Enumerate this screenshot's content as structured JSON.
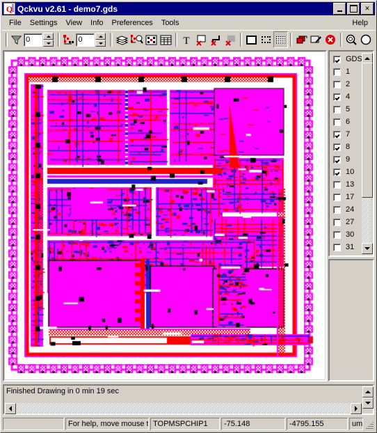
{
  "window": {
    "title": "Qckvu v2.61 - demo7.gds",
    "icon": "app-q-icon",
    "buttons": [
      {
        "name": "minimize-button",
        "label": "_"
      },
      {
        "name": "maximize-button",
        "label": "□"
      },
      {
        "name": "close-button",
        "label": "✕"
      }
    ]
  },
  "menu": {
    "items": [
      "File",
      "Settings",
      "View",
      "Info",
      "Preferences",
      "Tools"
    ],
    "help": "Help"
  },
  "toolbar": {
    "filter_value": "0",
    "filter_icon": "funnel-filter-icon",
    "depth_value": "0",
    "depth_icon": "hierarchy-depth-icon",
    "tools": [
      {
        "name": "layers-icon",
        "title": "Layers"
      },
      {
        "name": "inspect-hierarchy-icon",
        "title": "Inspect"
      },
      {
        "name": "cell-array-icon",
        "title": "Cell Array"
      },
      {
        "name": "table-grid-icon",
        "title": "Table"
      },
      {
        "name": "text-tool-icon",
        "title": "Text"
      },
      {
        "name": "hide-box-icon",
        "title": "Hide Box"
      },
      {
        "name": "hide-path-icon",
        "title": "Hide Path"
      },
      {
        "name": "hide-fill-icon",
        "title": "Hide Fill"
      },
      {
        "name": "outline-fill-icon",
        "title": "Outline"
      },
      {
        "name": "dotted-fill-icon",
        "title": "Dot Fill"
      },
      {
        "name": "solid-fill-icon",
        "title": "Solid Fill"
      },
      {
        "name": "color-swap-icon",
        "title": "Colors"
      },
      {
        "name": "edit-layer-icon",
        "title": "Edit Layer"
      },
      {
        "name": "cancel-icon",
        "title": "Cancel"
      },
      {
        "name": "zoom-in-icon",
        "title": "Zoom In"
      },
      {
        "name": "zoom-fit-icon",
        "title": "Zoom Fit"
      }
    ]
  },
  "layers": {
    "items": [
      {
        "label": "GDS",
        "checked": true
      },
      {
        "label": "1",
        "checked": false
      },
      {
        "label": "2",
        "checked": false
      },
      {
        "label": "4",
        "checked": true
      },
      {
        "label": "5",
        "checked": false
      },
      {
        "label": "6",
        "checked": false
      },
      {
        "label": "7",
        "checked": true
      },
      {
        "label": "8",
        "checked": true
      },
      {
        "label": "9",
        "checked": true
      },
      {
        "label": "10",
        "checked": true
      },
      {
        "label": "13",
        "checked": false
      },
      {
        "label": "17",
        "checked": false
      },
      {
        "label": "24",
        "checked": false
      },
      {
        "label": "27",
        "checked": false
      },
      {
        "label": "30",
        "checked": false
      },
      {
        "label": "31",
        "checked": false
      }
    ]
  },
  "message": {
    "text": "Finished Drawing in 0 min 19 sec"
  },
  "statusbar": {
    "panel1": "",
    "help": "For help, move mouse to",
    "cell": "TOPMSPCHIP1",
    "x": "-75.148",
    "y": "-4795.155",
    "units": "um"
  },
  "canvas": {
    "layout_colors": {
      "magenta": "#ff00ff",
      "red": "#ff0000",
      "blue": "#2222cc",
      "black": "#000000",
      "background": "#ffffff"
    },
    "description": "GDSII integrated circuit layout view of TOPMSPCHIP1"
  }
}
